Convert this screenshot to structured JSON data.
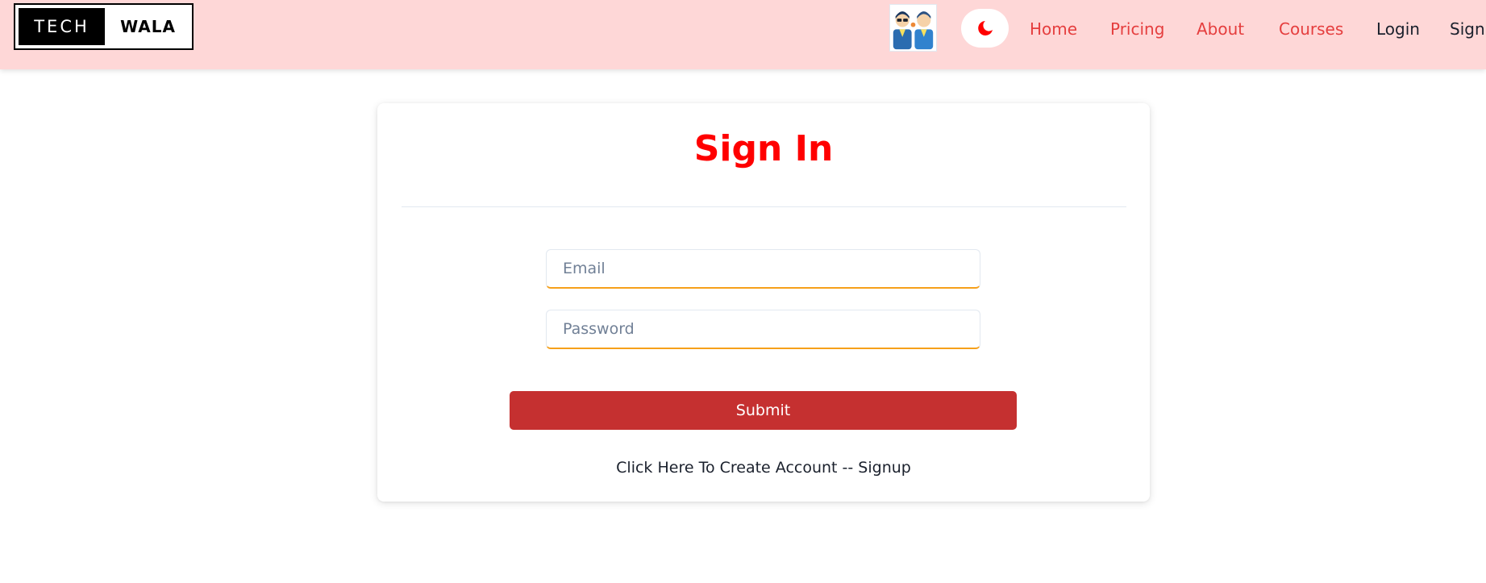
{
  "brand": {
    "left": "TECH",
    "right": "WALA"
  },
  "header": {
    "avatar_icon": "users-avatar-icon",
    "theme_toggle_icon": "moon-icon",
    "nav": {
      "home": "Home",
      "pricing": "Pricing",
      "about": "About",
      "courses": "Courses",
      "login": "Login",
      "signup": "Sign"
    }
  },
  "form": {
    "title": "Sign In",
    "email_placeholder": "Email",
    "email_value": "",
    "password_placeholder": "Password",
    "password_value": "",
    "submit_label": "Submit",
    "signup_prompt": "Click Here To Create Account -- Signup"
  },
  "colors": {
    "header_bg": "#fed7d7",
    "nav_link": "#e53e3e",
    "title": "#ff0000",
    "submit_bg": "#c53030",
    "input_accent": "#f6a01a"
  }
}
